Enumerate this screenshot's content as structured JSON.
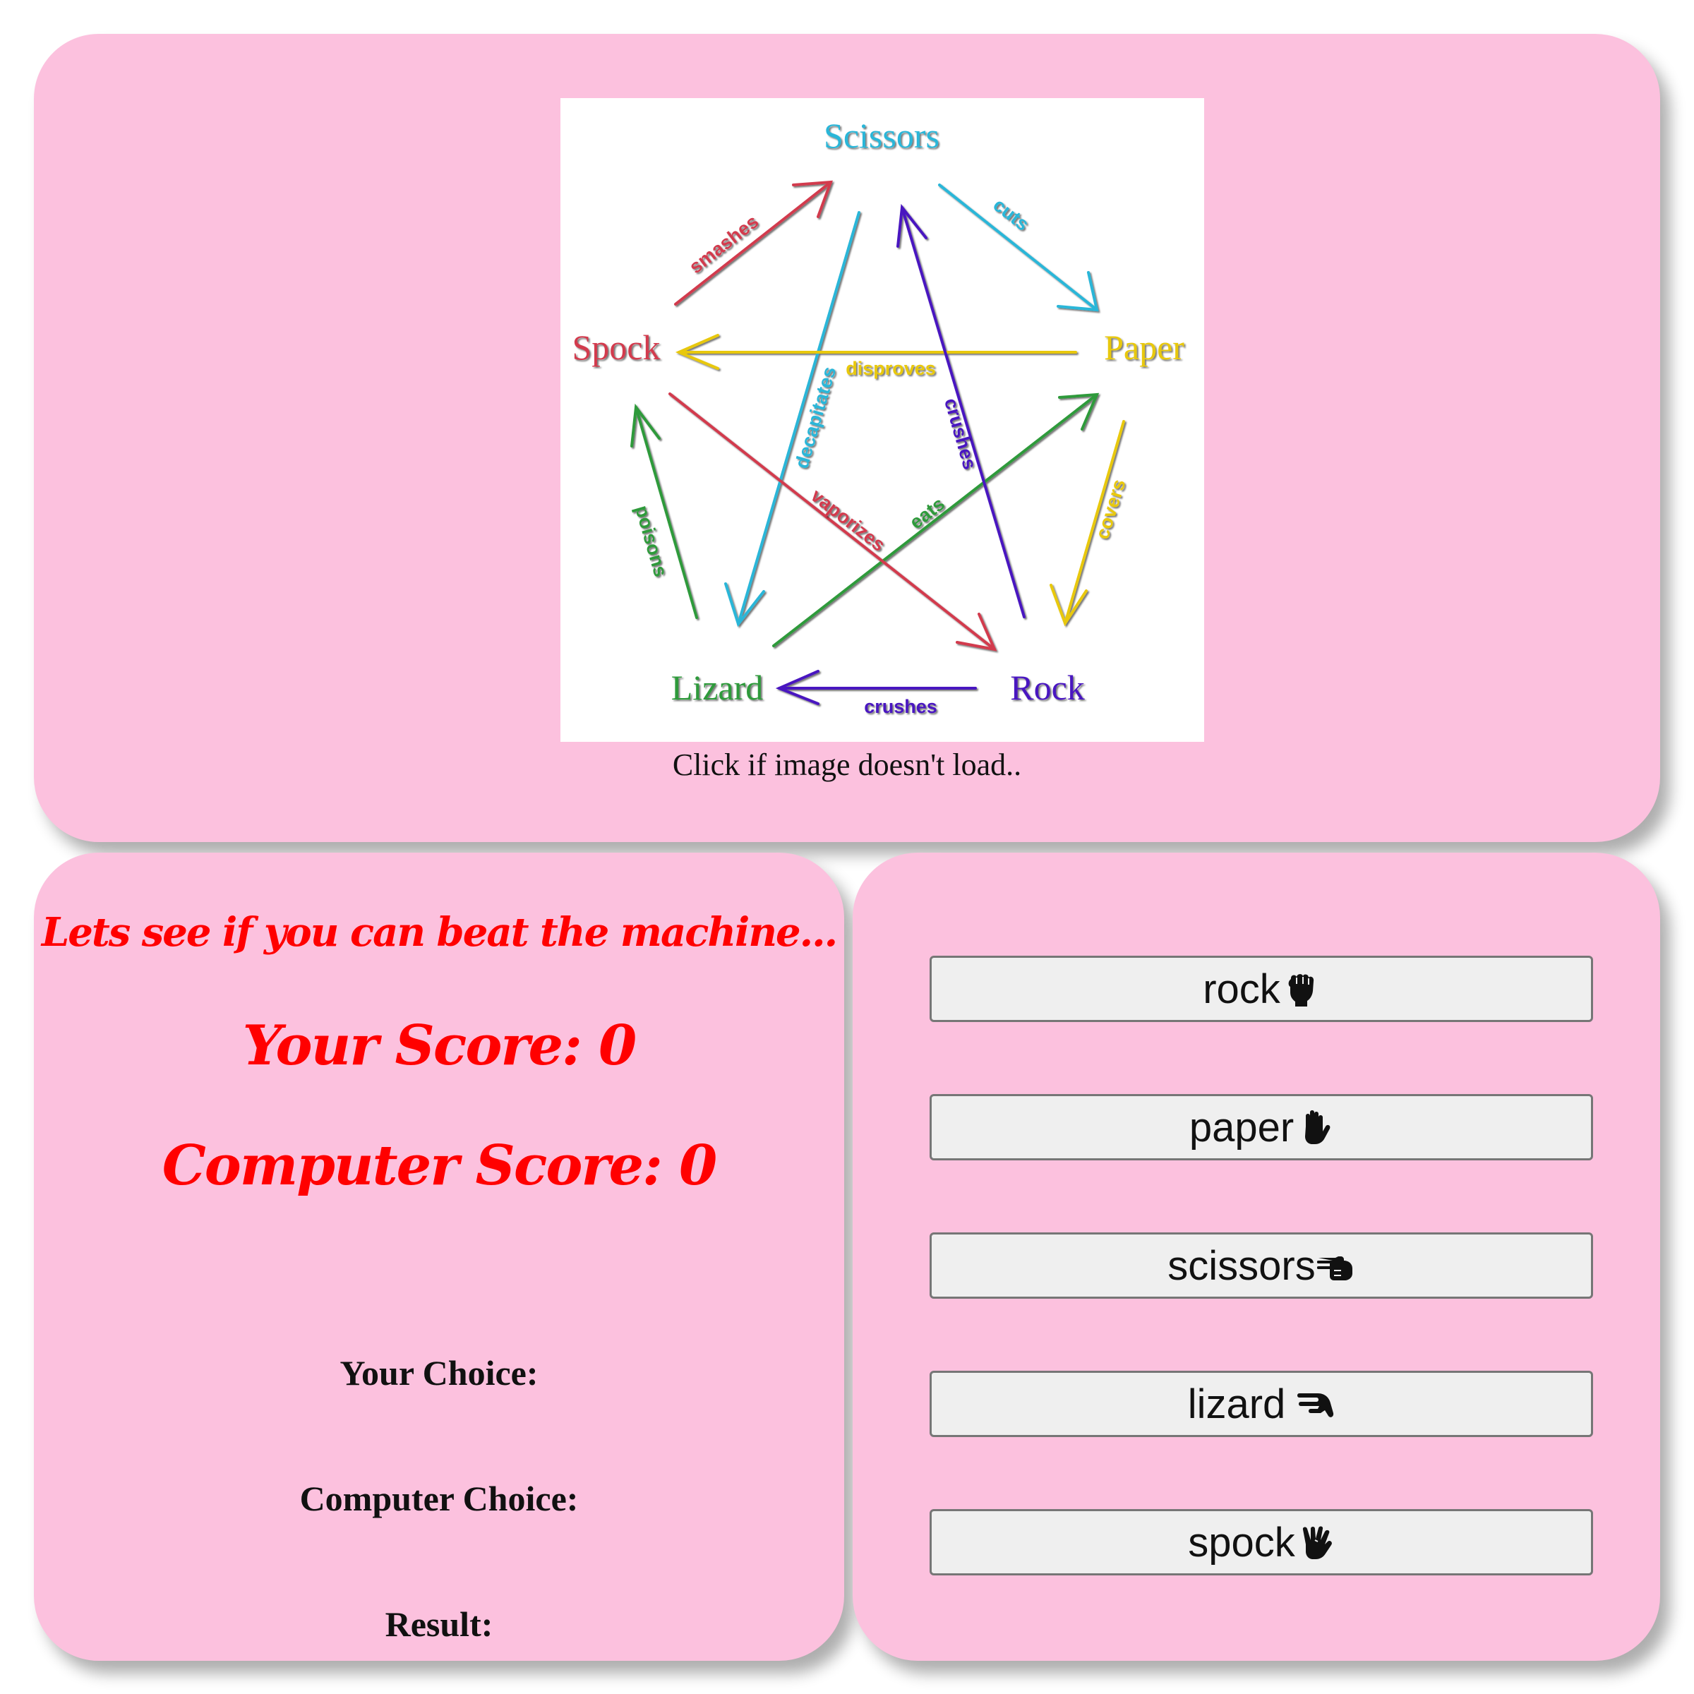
{
  "diagram": {
    "nodes": {
      "scissors": "Scissors",
      "paper": "Paper",
      "rock": "Rock",
      "lizard": "Lizard",
      "spock": "Spock"
    },
    "verbs": {
      "cuts": "cuts",
      "covers": "covers",
      "crushes_lizard": "crushes",
      "poisons": "poisons",
      "smashes": "smashes",
      "decapitates": "decapitates",
      "eats": "eats",
      "vaporizes": "vaporizes",
      "disproves": "disproves",
      "crushes_scissors": "crushes"
    },
    "colors": {
      "scissors": "#29b6d8",
      "paper": "#e8c80a",
      "rock": "#4a18c0",
      "lizard": "#2e9a3a",
      "spock": "#d23a4e"
    }
  },
  "image_caption": "Click if image doesn't load..",
  "scoreboard": {
    "tagline": "Lets see if you can beat the machine...",
    "your_score": "Your Score: 0",
    "computer_score": "Computer Score: 0",
    "your_choice": "Your Choice:",
    "computer_choice": "Computer Choice:",
    "result": "Result:",
    "text_color": "#ff0000"
  },
  "choices": [
    {
      "label": "rock",
      "icon": "fist-icon"
    },
    {
      "label": "paper",
      "icon": "open-hand-icon"
    },
    {
      "label": "scissors",
      "icon": "scissors-hand-icon"
    },
    {
      "label": "lizard",
      "icon": "lizard-hand-icon"
    },
    {
      "label": "spock",
      "icon": "spock-hand-icon"
    }
  ],
  "theme": {
    "card_background": "#fcc1de",
    "button_background": "#efefef"
  }
}
